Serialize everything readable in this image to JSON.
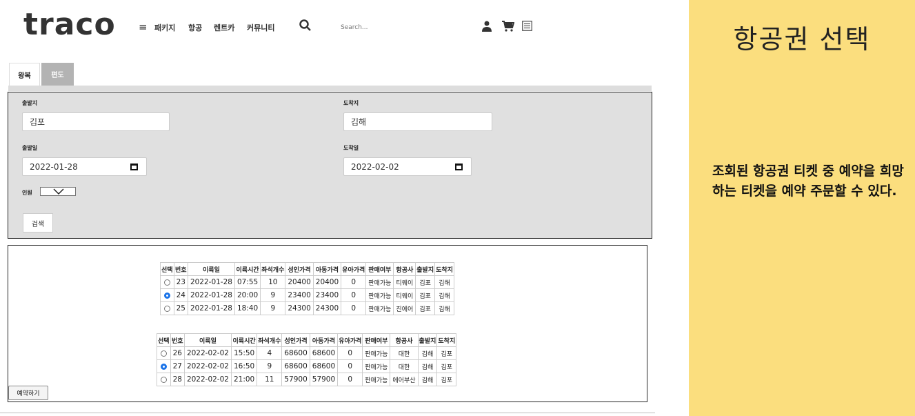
{
  "nav": {
    "logo": "traco",
    "menu_glyph": "≡",
    "links": [
      "패키지",
      "항공",
      "렌트카",
      "커뮤니티"
    ],
    "search_placeholder": "Search..."
  },
  "tabs": {
    "round_trip": "왕복",
    "one_way": "편도"
  },
  "form": {
    "departure_label": "출발지",
    "departure_value": "김포",
    "arrival_label": "도착지",
    "arrival_value": "김해",
    "depart_date_label": "출발일",
    "depart_date_value": "2022-01-28",
    "arrive_date_label": "도착일",
    "arrive_date_value": "2022-02-02",
    "people_label": "인원",
    "search_button": "검색"
  },
  "tables": {
    "headers": [
      "선택",
      "번호",
      "이륙일",
      "이륙시간",
      "좌석개수",
      "성인가격",
      "아동가격",
      "유아가격",
      "판매여부",
      "항공사",
      "출발지",
      "도착지"
    ],
    "outbound": [
      {
        "selected": false,
        "no": "23",
        "date": "2022-01-28",
        "time": "07:55",
        "seats": "10",
        "adult": "20400",
        "child": "20400",
        "infant": "0",
        "sale": "판매가능",
        "airline": "티웨이",
        "from": "김포",
        "to": "김해"
      },
      {
        "selected": true,
        "no": "24",
        "date": "2022-01-28",
        "time": "20:00",
        "seats": "9",
        "adult": "23400",
        "child": "23400",
        "infant": "0",
        "sale": "판매가능",
        "airline": "티웨이",
        "from": "김포",
        "to": "김해"
      },
      {
        "selected": false,
        "no": "25",
        "date": "2022-01-28",
        "time": "18:40",
        "seats": "9",
        "adult": "24300",
        "child": "24300",
        "infant": "0",
        "sale": "판매가능",
        "airline": "진에어",
        "from": "김포",
        "to": "김해"
      }
    ],
    "inbound": [
      {
        "selected": false,
        "no": "26",
        "date": "2022-02-02",
        "time": "15:50",
        "seats": "4",
        "adult": "68600",
        "child": "68600",
        "infant": "0",
        "sale": "판매가능",
        "airline": "대한",
        "from": "김해",
        "to": "김포"
      },
      {
        "selected": true,
        "no": "27",
        "date": "2022-02-02",
        "time": "16:50",
        "seats": "9",
        "adult": "68600",
        "child": "68600",
        "infant": "0",
        "sale": "판매가능",
        "airline": "대한",
        "from": "김해",
        "to": "김포"
      },
      {
        "selected": false,
        "no": "28",
        "date": "2022-02-02",
        "time": "21:00",
        "seats": "11",
        "adult": "57900",
        "child": "57900",
        "infant": "0",
        "sale": "판매가능",
        "airline": "에어부산",
        "from": "김해",
        "to": "김포"
      }
    ],
    "reserve_button": "예약하기"
  },
  "info": {
    "title": "항공권 선택",
    "description": "조회된 항공권 티켓 중 예약을 희망하는 티켓을 예약 주문할 수 있다."
  },
  "colors": {
    "info_bg": "#fbde7e",
    "form_bg": "#e0e0e0",
    "tab_inactive": "#b3b3b3",
    "radio_selected": "#1a73e8"
  },
  "icons": [
    "menu-icon",
    "search-icon",
    "user-icon",
    "cart-icon",
    "list-icon",
    "calendar-icon",
    "chevron-down-icon"
  ]
}
